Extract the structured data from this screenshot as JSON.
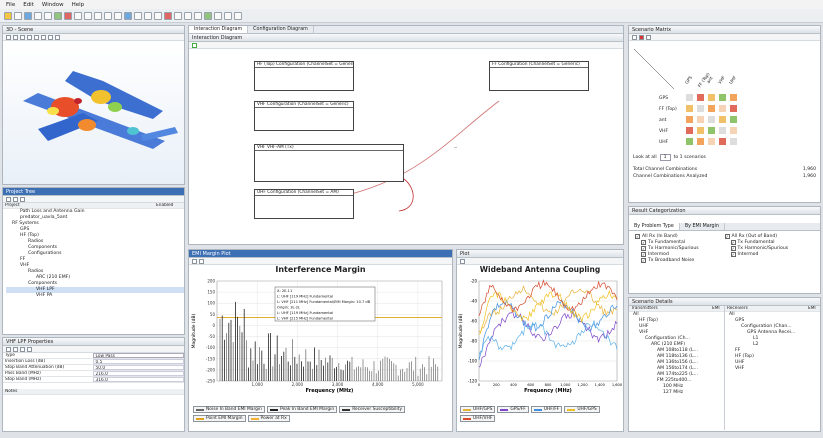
{
  "menu": [
    "File",
    "Edit",
    "Window",
    "Help"
  ],
  "scene": {
    "title": "3D - Scene"
  },
  "project_tree": {
    "title": "Project Tree",
    "col_project": "Project",
    "col_enabled": "Enabled",
    "items": [
      "Path Loss and Antenna Gain",
      "predator_uavla_5ant",
      "RF Systems",
      "GPS",
      "HF (Top)",
      "Radios",
      "Components",
      "Configurations",
      "FF",
      "VHF",
      "Radios",
      "ARC (210 EMF)",
      "Components",
      "VHF LPF",
      "VHF PA"
    ]
  },
  "properties": {
    "title": "VHF LPF Properties",
    "type_label": "Type",
    "type_value": "Low Pass",
    "rows": [
      {
        "k": "Insertion Loss (dB)",
        "v": "0.5"
      },
      {
        "k": "Stop Band Attenuation (dB)",
        "v": "50.0"
      },
      {
        "k": "Pass Band (MHz)",
        "v": "216.0"
      },
      {
        "k": "Stop Band (MHz)",
        "v": "316.0"
      }
    ],
    "notes": "Notes"
  },
  "diagram": {
    "tabs": [
      "Interaction Diagram",
      "Configuration Diagram"
    ],
    "title": "Interaction Diagram",
    "boxes": [
      "HF (Top) Configuration (ChannelSet = Generic)",
      "FF Configuration (ChannelSet = Generic)",
      "VHF Configuration (ChannelSet = Generic)",
      "VHF VHF-AM (Tx)",
      "UHF Configuration (ChannelSet = AM)"
    ],
    "dash": "--"
  },
  "emi": {
    "tab": "EMI Margin Plot",
    "title": "Interference Margin",
    "ylabel": "Magnitude (dB)",
    "xlabel": "Frequency (MHz)",
    "yticks": [
      "200",
      "150",
      "100",
      "50",
      "0",
      "-50",
      "-100",
      "-150",
      "-200",
      "-250"
    ],
    "xticks": [
      "1,000",
      "2,000",
      "3,000",
      "4,000",
      "5,000"
    ],
    "annotation": [
      "X: 2E-11",
      "L: UHF [119 MHz] Fundamental",
      "L: VHF [211 MHz] Fundamental/EMI Margin: 10.7 dB",
      "Origin: 3L-2L",
      "L: UHF [119 MHz] Fundamental",
      "L: VHF [215 MHz] Fundamental"
    ],
    "legend": [
      "Noise In Band EMI Margin",
      "Peak In Band EMI Margin",
      "Receiver Susceptibility",
      "Point EMI Margin",
      "Power at Rx"
    ],
    "colors": {
      "noise": "#666666",
      "peak": "#222222",
      "recv": "#333333",
      "point": "#e0a31a",
      "power": "#f0b030"
    }
  },
  "plot": {
    "tab": "Plot",
    "title": "Wideband Antenna Coupling",
    "ylabel": "Magnitude (dB)",
    "xlabel": "Frequency (MHz)",
    "yticks": [
      "-20",
      "-40",
      "-60",
      "-80",
      "-100",
      "-120"
    ],
    "xticks": [
      "0",
      "200",
      "400",
      "600",
      "800",
      "1,000",
      "1,200",
      "1,400",
      "1,600"
    ],
    "legend": [
      "UHF/GPS",
      "GPS/FF",
      "UHF/FF",
      "UHF/GPS",
      "UHF/VHF",
      "UHF/VHF"
    ],
    "colors": [
      "#e8b33a",
      "#7b46c9",
      "#3f8fdf",
      "#f2c01e",
      "#d64a2e",
      "#5fb0e8"
    ]
  },
  "matrix": {
    "title": "Scenario Matrix",
    "rows": [
      "GPS",
      "FF (Top)",
      "ant",
      "VHF",
      "UHF"
    ],
    "cols": [
      "GPS",
      "FF (Top)",
      "ant",
      "VHF",
      "UHF"
    ],
    "look_at": "Look at all",
    "look_val": "1",
    "look_suffix": "to 1 scenarios",
    "total_label": "Total Channel Combinations",
    "total_val": "1,960",
    "analyzed_label": "Channel Combinations Analyzed",
    "analyzed_val": "1,960"
  },
  "categorization": {
    "title": "Result Categorization",
    "tabs": [
      "By Problem Type",
      "By EMI Margin"
    ],
    "checks": [
      {
        "label": "All Rx (In Band)",
        "on": true
      },
      {
        "label": "All Rx (Out of Band)",
        "on": true
      },
      {
        "label": "Tx Fundamental",
        "on": true
      },
      {
        "label": "Tx Fundamental",
        "on": true
      },
      {
        "label": "Tx Harmonic/Spurious",
        "on": true
      },
      {
        "label": "Tx Harmonic/Spurious",
        "on": true
      },
      {
        "label": "Intermod",
        "on": true
      },
      {
        "label": "Intermod",
        "on": true
      },
      {
        "label": "Tx Broadband Noise",
        "on": true
      }
    ]
  },
  "details": {
    "title": "Scenario Details",
    "tx_header": "Transmitters",
    "tx_sub": "EMI",
    "rx_header": "Receivers",
    "rx_sub": "EMI",
    "tx": [
      "All",
      "HF (Top)",
      "UHF",
      "VHF",
      "Configuration (Ch...",
      "ARC (210 EMF)",
      "AM 108to118 (L...",
      "AM 118to136 (L...",
      "AM 136to156 (L...",
      "AM 156to174 (L...",
      "AM 174to225 (L...",
      "FM 225to400...",
      "100 MHz",
      "127 MHz"
    ],
    "rx": [
      "All",
      "GPS",
      "Configuration (Chan...",
      "GPS Antenna Recei...",
      "L1",
      "L2",
      "FF",
      "HF (Top)",
      "UHF",
      "VHF"
    ]
  }
}
